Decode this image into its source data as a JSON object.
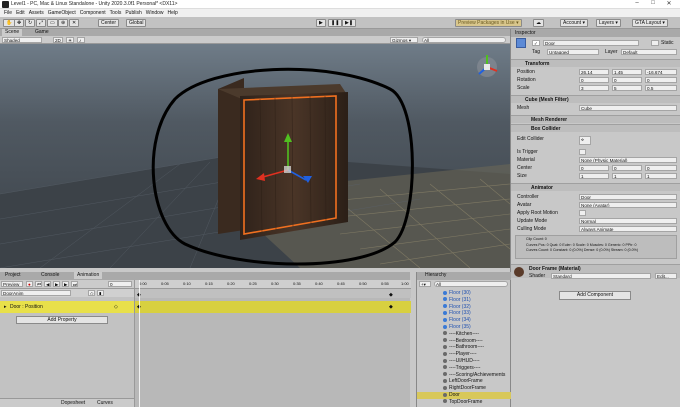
{
  "window": {
    "title": "Level1 - PC, Mac & Linux Standalone - Unity 2020.3.0f1 Personal* <DX11>",
    "minimize": "–",
    "maximize": "□",
    "close": "✕"
  },
  "menu": [
    "File",
    "Edit",
    "Assets",
    "GameObject",
    "Component",
    "Tools",
    "Publish",
    "Window",
    "Help"
  ],
  "toolbar": {
    "center": "Center",
    "global": "Global",
    "packages": "Preview Packages in Use ▾",
    "account": "Account ▾",
    "layers": "Layers ▾",
    "layout": "GTA Layout ▾"
  },
  "scene": {
    "tabs": [
      "Scene",
      "Game"
    ],
    "shading": "Shaded",
    "mode_2d": "2D",
    "gizmos": "Gizmos ▾",
    "search_placeholder": "All"
  },
  "inspector": {
    "tab": "Inspector",
    "object_name": "Door",
    "static_label": "Static",
    "tag_label": "Tag",
    "tag_value": "Untagged",
    "layer_label": "Layer",
    "layer_value": "Default",
    "transform": {
      "title": "Transform",
      "position_label": "Position",
      "rotation_label": "Rotation",
      "scale_label": "Scale",
      "position": [
        "26.14",
        "1.45",
        "-16.674"
      ],
      "rotation": [
        "0",
        "0",
        "0"
      ],
      "scale": [
        "3",
        "5",
        "0.5"
      ]
    },
    "mesh_filter": {
      "title": "Cube (Mesh Filter)",
      "mesh_label": "Mesh",
      "mesh_value": "Cube"
    },
    "mesh_renderer": {
      "title": "Mesh Renderer"
    },
    "box_collider": {
      "title": "Box Collider",
      "edit_label": "Edit Collider",
      "trigger_label": "Is Trigger",
      "material_label": "Material",
      "material_value": "None (Physic Material)",
      "center_label": "Center",
      "center": [
        "0",
        "0",
        "0"
      ],
      "size_label": "Size",
      "size": [
        "1",
        "1",
        "1"
      ]
    },
    "animator": {
      "title": "Animator",
      "controller_label": "Controller",
      "controller_value": "Door",
      "avatar_label": "Avatar",
      "avatar_value": "None (Avatar)",
      "root_motion_label": "Apply Root Motion",
      "update_label": "Update Mode",
      "update_value": "Normal",
      "culling_label": "Culling Mode",
      "culling_value": "Always Animate",
      "info": [
        "Clip Count: 0",
        "Curves Pos: 0 Quat: 0 Euler: 0 Scale: 0 Muscles: 0 Generic: 0 PPtr: 0",
        "Curves Count: 0 Constant: 0 (0.0%) Dense: 0 (0.0%) Stream: 0 (0.0%)"
      ]
    },
    "material": {
      "title": "Door Frame (Material)",
      "shader_label": "Shader",
      "shader_value": "Standard",
      "edit": "Edit..."
    },
    "add_component": "Add Component"
  },
  "animation": {
    "tabs": [
      "Project",
      "Console",
      "Animation"
    ],
    "preview": "Preview",
    "frame": "0",
    "clip": "DoorAnim",
    "property": "Door : Position",
    "add_property": "Add Property",
    "footer_tabs": [
      "Dopesheet",
      "Curves"
    ],
    "ruler": [
      "0:00",
      "0:05",
      "0:10",
      "0:15",
      "0:20",
      "0:25",
      "0:30",
      "0:35",
      "0:40",
      "0:45",
      "0:50",
      "0:55",
      "1:00"
    ]
  },
  "hierarchy": {
    "tab": "Hierarchy",
    "search_placeholder": "All",
    "items": [
      {
        "label": "Floor (30)",
        "type": "blue"
      },
      {
        "label": "Floor (31)",
        "type": "blue"
      },
      {
        "label": "Floor (32)",
        "type": "blue"
      },
      {
        "label": "Floor (33)",
        "type": "blue"
      },
      {
        "label": "Floor (34)",
        "type": "blue"
      },
      {
        "label": "Floor (35)",
        "type": "blue"
      },
      {
        "label": "----Kitchen----",
        "type": "gray"
      },
      {
        "label": "----Bedroom----",
        "type": "gray"
      },
      {
        "label": "----Bathroom----",
        "type": "gray"
      },
      {
        "label": "----Player----",
        "type": "gray"
      },
      {
        "label": "----UI/HUD----",
        "type": "gray"
      },
      {
        "label": "----Triggers----",
        "type": "gray"
      },
      {
        "label": "----Scoring/Achievements",
        "type": "gray"
      },
      {
        "label": "LeftDoorFrame",
        "type": "gray"
      },
      {
        "label": "RightDoorFrame",
        "type": "gray"
      },
      {
        "label": "Door",
        "type": "selected"
      },
      {
        "label": "TopDoorFrame",
        "type": "gray"
      }
    ]
  },
  "colors": {
    "selection": "#e8e04a",
    "hierarchy_selected": "#d8c85a",
    "frame_outline": "#f07020",
    "gizmo_x": "#e03020",
    "gizmo_y": "#50c020",
    "gizmo_z": "#2060e0"
  }
}
